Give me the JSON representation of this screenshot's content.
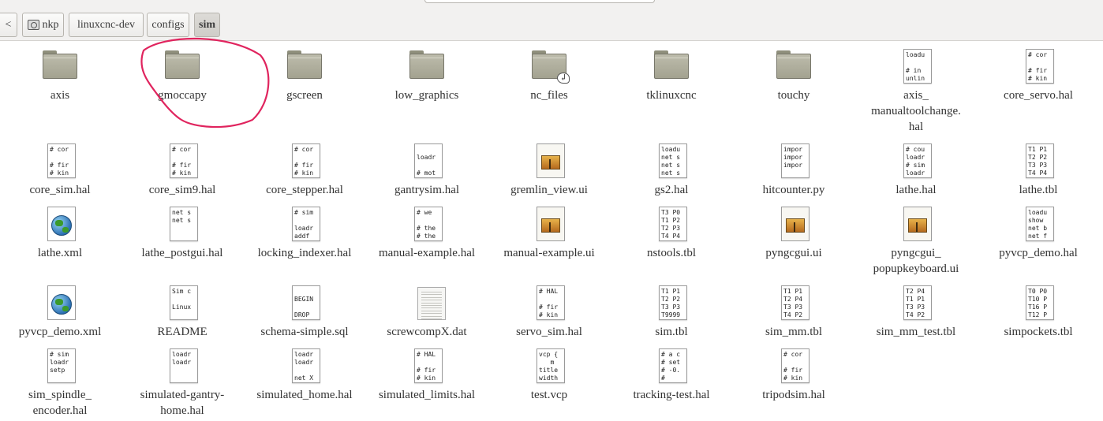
{
  "breadcrumb": {
    "back_label": "<",
    "items": [
      {
        "label": "nkp",
        "icon": "home-folder-icon"
      },
      {
        "label": "linuxcnc-dev"
      },
      {
        "label": "configs"
      },
      {
        "label": "sim",
        "active": true
      }
    ]
  },
  "files": [
    {
      "name": "axis",
      "type": "folder"
    },
    {
      "name": "gmoccapy",
      "type": "folder"
    },
    {
      "name": "gscreen",
      "type": "folder"
    },
    {
      "name": "low_graphics",
      "type": "folder"
    },
    {
      "name": "nc_files",
      "type": "folder-link"
    },
    {
      "name": "tklinuxcnc",
      "type": "folder"
    },
    {
      "name": "touchy",
      "type": "folder"
    },
    {
      "name": "axis_\nmanualtoolchange.\nhal",
      "type": "text",
      "preview": "loadu\n\n# in\nunlin"
    },
    {
      "name": "core_servo.hal",
      "type": "text",
      "preview": "# cor\n\n# fir\n# kin"
    },
    {
      "name": "core_sim.hal",
      "type": "text",
      "preview": "# cor\n\n# fir\n# kin"
    },
    {
      "name": "core_sim9.hal",
      "type": "text",
      "preview": "# cor\n\n# fir\n# kin"
    },
    {
      "name": "core_stepper.hal",
      "type": "text",
      "preview": "# cor\n\n# fir\n# kin"
    },
    {
      "name": "gantrysim.hal",
      "type": "text",
      "preview": "\nloadr\n\n# mot"
    },
    {
      "name": "gremlin_view.ui",
      "type": "image"
    },
    {
      "name": "gs2.hal",
      "type": "text",
      "preview": "loadu\nnet s\nnet s\nnet s"
    },
    {
      "name": "hitcounter.py",
      "type": "text",
      "preview": "impor\nimpor\nimpor"
    },
    {
      "name": "lathe.hal",
      "type": "text",
      "preview": "# cou\nloadr\n# sim\nloadr"
    },
    {
      "name": "lathe.tbl",
      "type": "text",
      "preview": "T1 P1\nT2 P2\nT3 P3\nT4 P4"
    },
    {
      "name": "lathe.xml",
      "type": "xml"
    },
    {
      "name": "lathe_postgui.hal",
      "type": "text",
      "preview": "net s\nnet s"
    },
    {
      "name": "locking_indexer.hal",
      "type": "text",
      "preview": "# sim\n\nloadr\naddf"
    },
    {
      "name": "manual-example.hal",
      "type": "text",
      "preview": "# we\n\n# the\n# the"
    },
    {
      "name": "manual-example.ui",
      "type": "image"
    },
    {
      "name": "nstools.tbl",
      "type": "text",
      "preview": "T3 P0\nT1 P2\nT2 P3\nT4 P4"
    },
    {
      "name": "pyngcgui.ui",
      "type": "image"
    },
    {
      "name": "pyngcgui_\npopupkeyboard.ui",
      "type": "image"
    },
    {
      "name": "pyvcp_demo.hal",
      "type": "text",
      "preview": "loadu\nshow\nnet b\nnet f"
    },
    {
      "name": "pyvcp_demo.xml",
      "type": "xml"
    },
    {
      "name": "README",
      "type": "text",
      "preview": "Sim c\n\nLinux"
    },
    {
      "name": "schema-simple.sql",
      "type": "text",
      "preview": "\nBEGIN\n\nDROP"
    },
    {
      "name": "screwcompX.dat",
      "type": "lines"
    },
    {
      "name": "servo_sim.hal",
      "type": "text",
      "preview": "# HAL\n\n# fir\n# kin"
    },
    {
      "name": "sim.tbl",
      "type": "text",
      "preview": "T1 P1\nT2 P2\nT3 P3\nT9999"
    },
    {
      "name": "sim_mm.tbl",
      "type": "text",
      "preview": "T1 P1\nT2 P4\nT3 P3\nT4 P2"
    },
    {
      "name": "sim_mm_test.tbl",
      "type": "text",
      "preview": "T2 P4\nT1 P1\nT3 P3\nT4 P2"
    },
    {
      "name": "simpockets.tbl",
      "type": "text",
      "preview": "T0 P0\nT10 P\nT16 P\nT12 P"
    },
    {
      "name": "sim_spindle_\nencoder.hal",
      "type": "text",
      "preview": "# sim\nloadr\nsetp"
    },
    {
      "name": "simulated-gantry-\nhome.hal",
      "type": "text",
      "preview": "loadr\nloadr"
    },
    {
      "name": "simulated_home.hal",
      "type": "text",
      "preview": "loadr\nloadr\n\nnet X"
    },
    {
      "name": "simulated_limits.hal",
      "type": "text",
      "preview": "# HAL\n\n# fir\n# kin"
    },
    {
      "name": "test.vcp",
      "type": "text",
      "preview": "vcp {\n   m\ntitle\nwidth"
    },
    {
      "name": "tracking-test.hal",
      "type": "text",
      "preview": "# a c\n# set\n# -0.\n#"
    },
    {
      "name": "tripodsim.hal",
      "type": "text",
      "preview": "# cor\n\n# fir\n# kin"
    }
  ],
  "annotation": {
    "color": "#e0245e"
  }
}
